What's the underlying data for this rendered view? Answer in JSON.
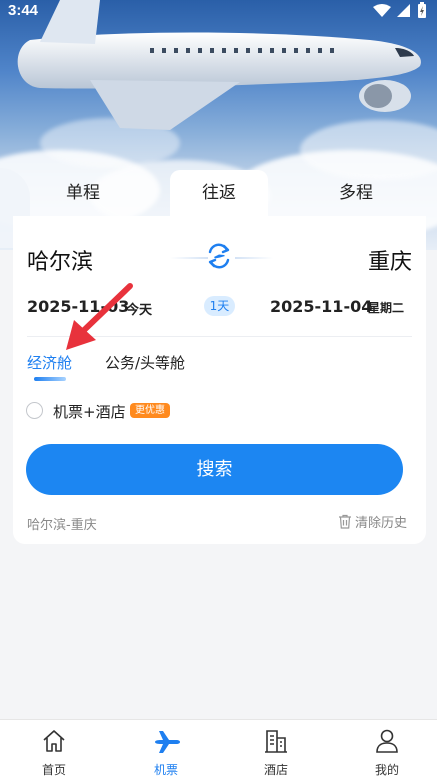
{
  "status_bar": {
    "time": "3:44"
  },
  "tabs": [
    {
      "label": "单程"
    },
    {
      "label": "往返"
    },
    {
      "label": "多程"
    }
  ],
  "route": {
    "from": "哈尔滨",
    "to": "重庆"
  },
  "dates": {
    "depart": "2025-11-03",
    "depart_day": "今天",
    "duration": "1天",
    "return": "2025-11-04",
    "return_day": "星期二"
  },
  "cabin": {
    "economy": "经济舱",
    "business": "公务/头等舱"
  },
  "combo": {
    "label": "机票+酒店",
    "badge": "更优惠"
  },
  "search_button": "搜索",
  "history": {
    "item": "哈尔滨-重庆",
    "clear": "清除历史"
  },
  "bottom_nav": [
    {
      "label": "首页",
      "icon": "home-icon"
    },
    {
      "label": "机票",
      "icon": "airplane-icon"
    },
    {
      "label": "酒店",
      "icon": "hotel-icon"
    },
    {
      "label": "我的",
      "icon": "user-icon"
    }
  ],
  "colors": {
    "accent": "#1e7ff0",
    "badge": "#ff8a1e",
    "annotation_arrow": "#e8323c"
  }
}
